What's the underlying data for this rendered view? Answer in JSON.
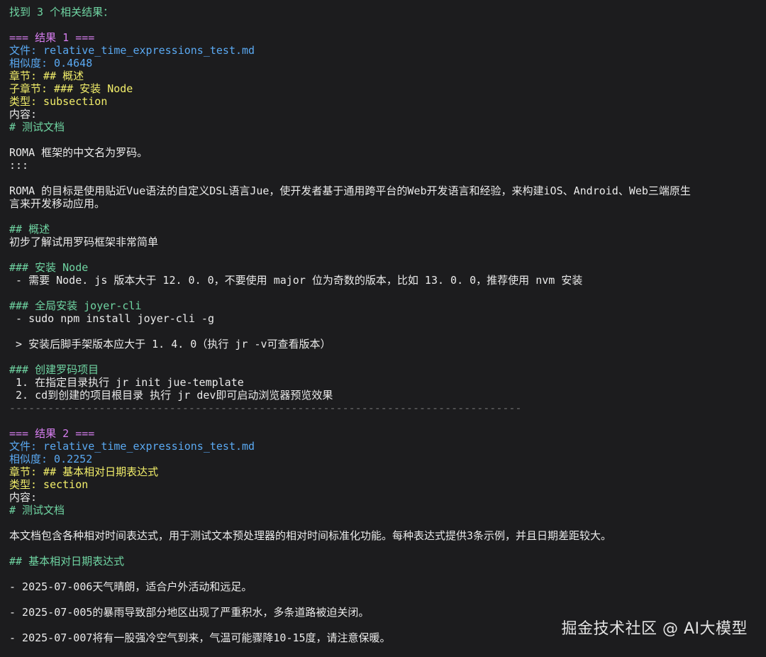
{
  "header": {
    "text": "找到 3 个相关结果："
  },
  "results": [
    {
      "heading": "=== 结果 1 ===",
      "file": "文件: relative_time_expressions_test.md",
      "similarity": "相似度: 0.4648",
      "section": "章节: ## 概述",
      "subsection": "子章节: ### 安装 Node",
      "type": "类型: subsection",
      "content_label": "内容:",
      "doc_title": "# 测试文档",
      "body": {
        "l1": "ROMA 框架的中文名为罗码。",
        "l2": ":::",
        "l3": "ROMA 的目标是使用贴近Vue语法的自定义DSL语言Jue，使开发者基于通用跨平台的Web开发语言和经验，来构建iOS、Android、Web三端原生",
        "l4": "言来开发移动应用。",
        "h_overview": "## 概述",
        "overview_text": "初步了解试用罗码框架非常简单",
        "h_install_node": "### 安装 Node",
        "install_node_text": " - 需要 Node. js 版本大于 12. 0. 0，不要使用 major 位为奇数的版本，比如 13. 0. 0，推荐使用 nvm 安装",
        "h_global": "### 全局安装 joyer-cli",
        "global_cmd": " - sudo npm install joyer-cli -g",
        "global_note": " > 安装后脚手架版本应大于 1. 4. 0（执行 jr -v可查看版本）",
        "h_create": "### 创建罗码项目",
        "step1": " 1. 在指定目录执行 jr init jue-template",
        "step2": " 2. cd到创建的项目根目录 执行 jr dev即可启动浏览器预览效果"
      },
      "separator": "--------------------------------------------------------------------------------"
    },
    {
      "heading": "=== 结果 2 ===",
      "file": "文件: relative_time_expressions_test.md",
      "similarity": "相似度: 0.2252",
      "section": "章节: ## 基本相对日期表达式",
      "type": "类型: section",
      "content_label": "内容:",
      "doc_title": "# 测试文档",
      "body": {
        "l1": "本文档包含各种相对时间表达式，用于测试文本预处理器的相对时间标准化功能。每种表达式提供3条示例，并且日期差距较大。",
        "h_basic": "## 基本相对日期表达式",
        "item1": "- 2025-07-006天气晴朗，适合户外活动和远足。",
        "item2": "- 2025-07-005的暴雨导致部分地区出现了严重积水，多条道路被迫关闭。",
        "item3": "- 2025-07-007将有一股强冷空气到来，气温可能骤降10-15度，请注意保暖。"
      }
    }
  ],
  "watermark": "掘金技术社区 @ AI大模型",
  "colors": {
    "background": "#1c1c1e",
    "green": "#6fd4a2",
    "magenta": "#d77ef0",
    "blue": "#5aa9f2",
    "yellow": "#f2ee6a",
    "separator": "#6d6d6d"
  }
}
